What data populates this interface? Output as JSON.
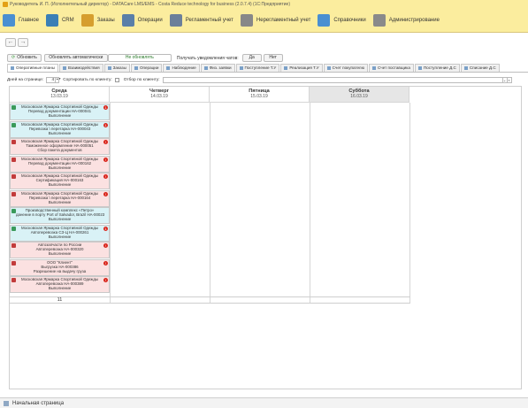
{
  "window": {
    "title": "Руководитель И. П. (Исполнительный директор) - DATACare LMS/EMS - Costa Reduce technology for business (2.0.7.4) (1С:Предприятие)"
  },
  "menu": [
    {
      "label": "Главное",
      "icon": "home-icon",
      "color": "#4a8fd1"
    },
    {
      "label": "CRM",
      "icon": "crm-icon",
      "color": "#3b7fb6"
    },
    {
      "label": "Заказы",
      "icon": "orders-icon",
      "color": "#d69e2e"
    },
    {
      "label": "Операции",
      "icon": "operations-icon",
      "color": "#5a7fa8"
    },
    {
      "label": "Регламентный учет",
      "icon": "calculator-icon",
      "color": "#6b7f9a"
    },
    {
      "label": "Нерегламентный учет",
      "icon": "person-icon",
      "color": "#888888"
    },
    {
      "label": "Справочники",
      "icon": "book-icon",
      "color": "#4a8fd1"
    },
    {
      "label": "Администрирование",
      "icon": "gear-icon",
      "color": "#8a8a8a"
    }
  ],
  "nav": {
    "back": "←",
    "forward": "→"
  },
  "toolbar": {
    "refresh": "Обновить",
    "auto_refresh": "Обновлять автоматически",
    "no_refresh": "Не обновлять",
    "chat_notifications": "Получать уведомления чатов:",
    "yes": "Да",
    "no": "Нет"
  },
  "tabs": [
    {
      "label": "Оперативные планы",
      "active": true
    },
    {
      "label": "Взаимодействия",
      "active": false
    },
    {
      "label": "Заказы",
      "active": false
    },
    {
      "label": "Операции",
      "active": false
    },
    {
      "label": "Наблюдение",
      "active": false
    },
    {
      "label": "Физ. заявки",
      "active": false
    },
    {
      "label": "Поступление Т.У",
      "active": false
    },
    {
      "label": "Реализация Т.У",
      "active": false
    },
    {
      "label": "Счет покупателю",
      "active": false
    },
    {
      "label": "Счет поставщика",
      "active": false
    },
    {
      "label": "Поступление Д.С",
      "active": false
    },
    {
      "label": "Списание Д.С",
      "active": false
    }
  ],
  "filter": {
    "days_label": "Дней на странице:",
    "days_value": "4",
    "sort_label": "Сортировать по клиенту:",
    "client_label": "Отбор по клиенту:",
    "client_value": ""
  },
  "columns": [
    {
      "day": "Среда",
      "date": "13.03.19",
      "selected": false
    },
    {
      "day": "Четверг",
      "date": "14.03.19",
      "selected": false
    },
    {
      "day": "Пятница",
      "date": "15.03.19",
      "selected": false
    },
    {
      "day": "Суббота",
      "date": "16.03.19",
      "selected": true
    }
  ],
  "cards": [
    {
      "lines": [
        "Московская Ярмарка Спортивной Одежды",
        "Перевод документации НА-000041",
        "Выполнение"
      ],
      "tone": "cyan",
      "badge": "1"
    },
    {
      "lines": [
        "Московская Ярмарка Спортивной Одежды",
        "Перевозка \\ перетарка НА-000043",
        "Выполнение"
      ],
      "tone": "cyan",
      "badge": "1"
    },
    {
      "lines": [
        "Московская Ярмарка Спортивной Одежды",
        "Таможенное оформление НА-000051",
        "Сбор пакета документов"
      ],
      "tone": "red",
      "badge": "!"
    },
    {
      "lines": [
        "Московская Ярмарка Спортивной Одежды",
        "Перевод документации НА-000162",
        "Выполнение"
      ],
      "tone": "red",
      "badge": "!"
    },
    {
      "lines": [
        "Московская Ярмарка Спортивной Одежды",
        "Сертификация НА-000163",
        "Выполнение"
      ],
      "tone": "red",
      "badge": "!"
    },
    {
      "lines": [
        "Московская Ярмарка Спортивной Одежды",
        "Перевозка \\ перетарка НА-000164",
        "Выполнение"
      ],
      "tone": "red",
      "badge": "!"
    },
    {
      "lines": [
        "Производственный комплекс «Петро»",
        "данение в порту Port of Salvador, Brazil НА-00023",
        "Выполнение"
      ],
      "tone": "cyan",
      "badge": ""
    },
    {
      "lines": [
        "Московская Ярмарка Спортивной Одежды",
        "Автоперевозка СЗ-Ц НА-000261",
        "Выполнение"
      ],
      "tone": "cyan",
      "badge": "1"
    },
    {
      "lines": [
        "Автозапчасти по России",
        "Автоперевозка НА-000320",
        "Выполнение"
      ],
      "tone": "red",
      "badge": "!"
    },
    {
      "lines": [
        "ООО \"Клиент\"",
        "Выгрузка НА-000386",
        "Разрешение на выдачу груза"
      ],
      "tone": "red",
      "badge": "!"
    },
    {
      "lines": [
        "Московская Ярмарка Спортивной Одежды",
        "Автоперевозка НА-000389",
        "Выполнение"
      ],
      "tone": "red",
      "badge": "!"
    }
  ],
  "count": "11",
  "statusbar": {
    "start_page": "Начальная страница"
  }
}
